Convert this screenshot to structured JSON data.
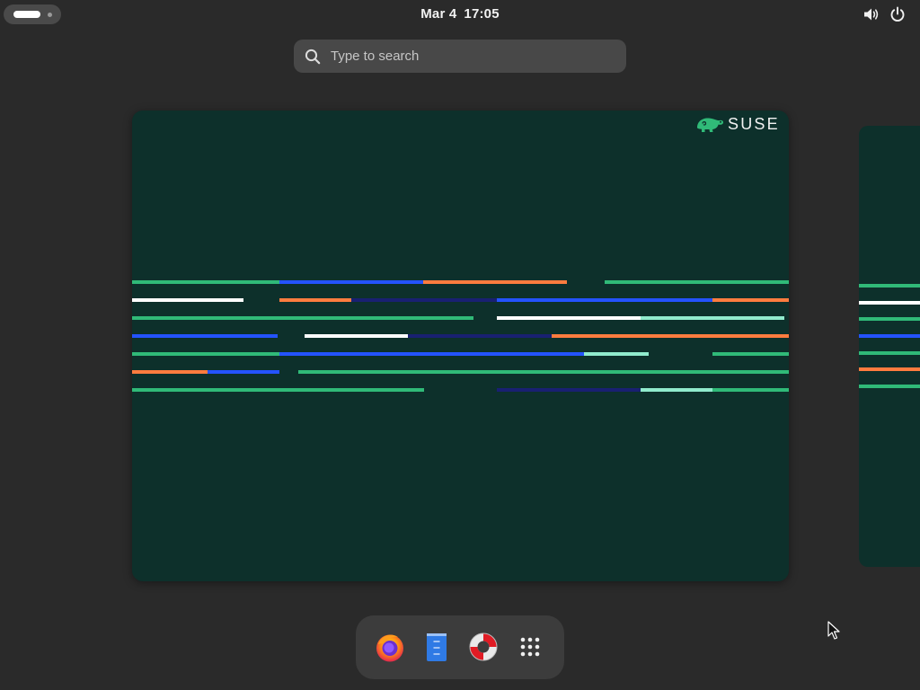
{
  "topbar": {
    "date": "Mar 4",
    "time": "17:05",
    "icons": [
      "activities-indicator",
      "volume-icon",
      "power-icon"
    ]
  },
  "search": {
    "placeholder": "Type to search"
  },
  "workspace": {
    "brand": "SUSE"
  },
  "dash": {
    "apps": [
      "firefox-icon",
      "text-editor-icon",
      "help-icon",
      "app-grid-icon"
    ]
  },
  "colors": {
    "panel": "#2a2a2a",
    "wallpaper": "#0d302b",
    "green": "#30ba78",
    "blue": "#2453ff",
    "orange": "#fe7c3f",
    "navy": "#192072",
    "mint": "#90ebcd",
    "white": "#ffffff"
  }
}
